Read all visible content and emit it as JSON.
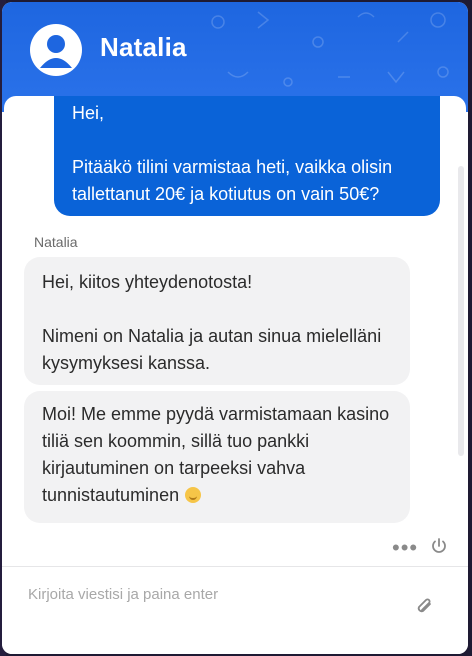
{
  "header": {
    "agent_name": "Natalia",
    "avatar_icon": "user-avatar-icon",
    "pattern_icon": "doodle-pattern"
  },
  "messages": {
    "user_1": {
      "line1": "Hei,",
      "line2": "Pitääkö tilini varmistaa heti, vaikka olisin tallettanut 20€ ja kotiutus on vain 50€?"
    },
    "agent_label": "Natalia",
    "agent_1": {
      "line1": "Hei, kiitos yhteydenotosta!",
      "line2": "Nimeni on Natalia ja autan sinua mielelläni kysymyksesi kanssa."
    },
    "agent_2": {
      "text": "Moi! Me emme pyydä varmistamaan kasino tiliä sen koommin, sillä tuo pankki kirjautuminen on tarpeeksi vahva tunnistautuminen"
    }
  },
  "toolbar": {
    "more_icon": "more-dots-icon",
    "end_chat_icon": "power-icon"
  },
  "composer": {
    "placeholder": "Kirjoita viestisi ja paina enter",
    "value": "",
    "attach_icon": "paperclip-icon"
  },
  "colors": {
    "header": "#1e66e0",
    "user_bubble": "#0a63d8",
    "agent_bubble": "#f2f2f3"
  }
}
